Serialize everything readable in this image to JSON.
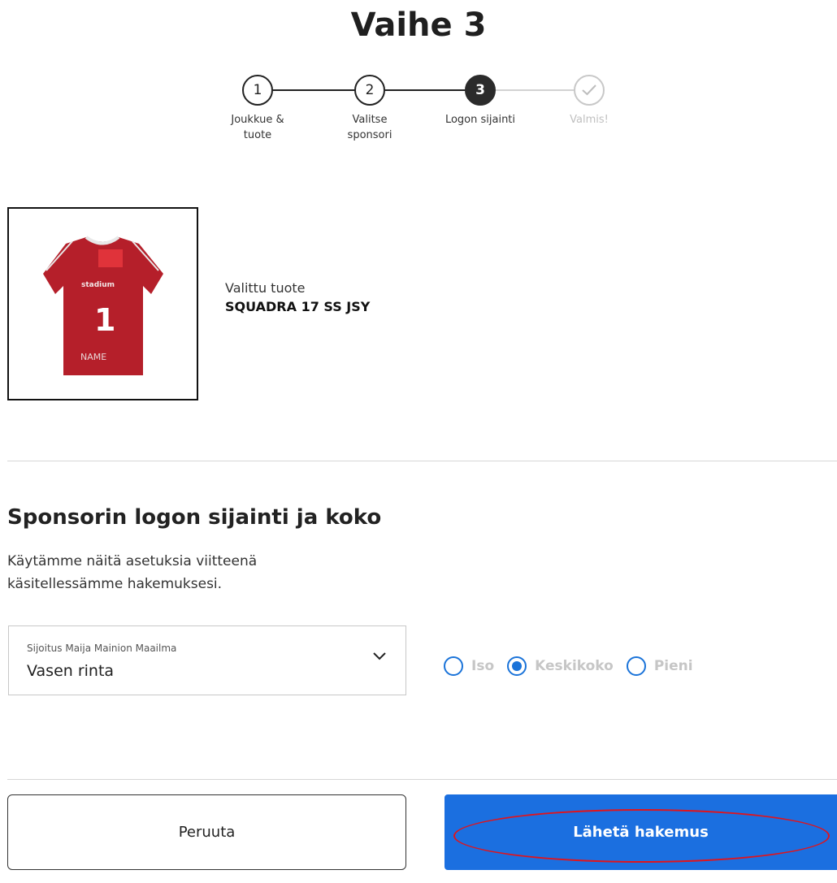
{
  "page": {
    "title": "Vaihe 3"
  },
  "stepper": {
    "steps": [
      {
        "number": "1",
        "label_line1": "Joukkue &",
        "label_line2": "tuote"
      },
      {
        "number": "2",
        "label_line1": "Valitse",
        "label_line2": "sponsori"
      },
      {
        "number": "3",
        "label_line1": "Logon sijainti",
        "label_line2": ""
      },
      {
        "number": "✓",
        "label_line1": "Valmis!",
        "label_line2": ""
      }
    ],
    "active_step": 3
  },
  "product": {
    "caption": "Valittu tuote",
    "name": "SQUADRA 17 SS JSY",
    "jersey_brand_text": "stadium",
    "jersey_number": "1",
    "jersey_name": "NAME",
    "jersey_color": "#b51f2a",
    "logo_marker_color": "#e0333a"
  },
  "logo_section": {
    "title": "Sponsorin logon sijainti ja koko",
    "description": "Käytämme näitä asetuksia viitteenä käsitellessämme hakemuksesi.",
    "placement_select": {
      "label": "Sijoitus Maija Mainion Maailma",
      "value": "Vasen rinta"
    },
    "size_options": [
      {
        "label": "Iso",
        "selected": false
      },
      {
        "label": "Keskikoko",
        "selected": true
      },
      {
        "label": "Pieni",
        "selected": false
      }
    ]
  },
  "actions": {
    "cancel_label": "Peruuta",
    "submit_label": "Lähetä hakemus"
  },
  "colors": {
    "accent": "#1b6fe0",
    "highlight": "#e0141c"
  }
}
